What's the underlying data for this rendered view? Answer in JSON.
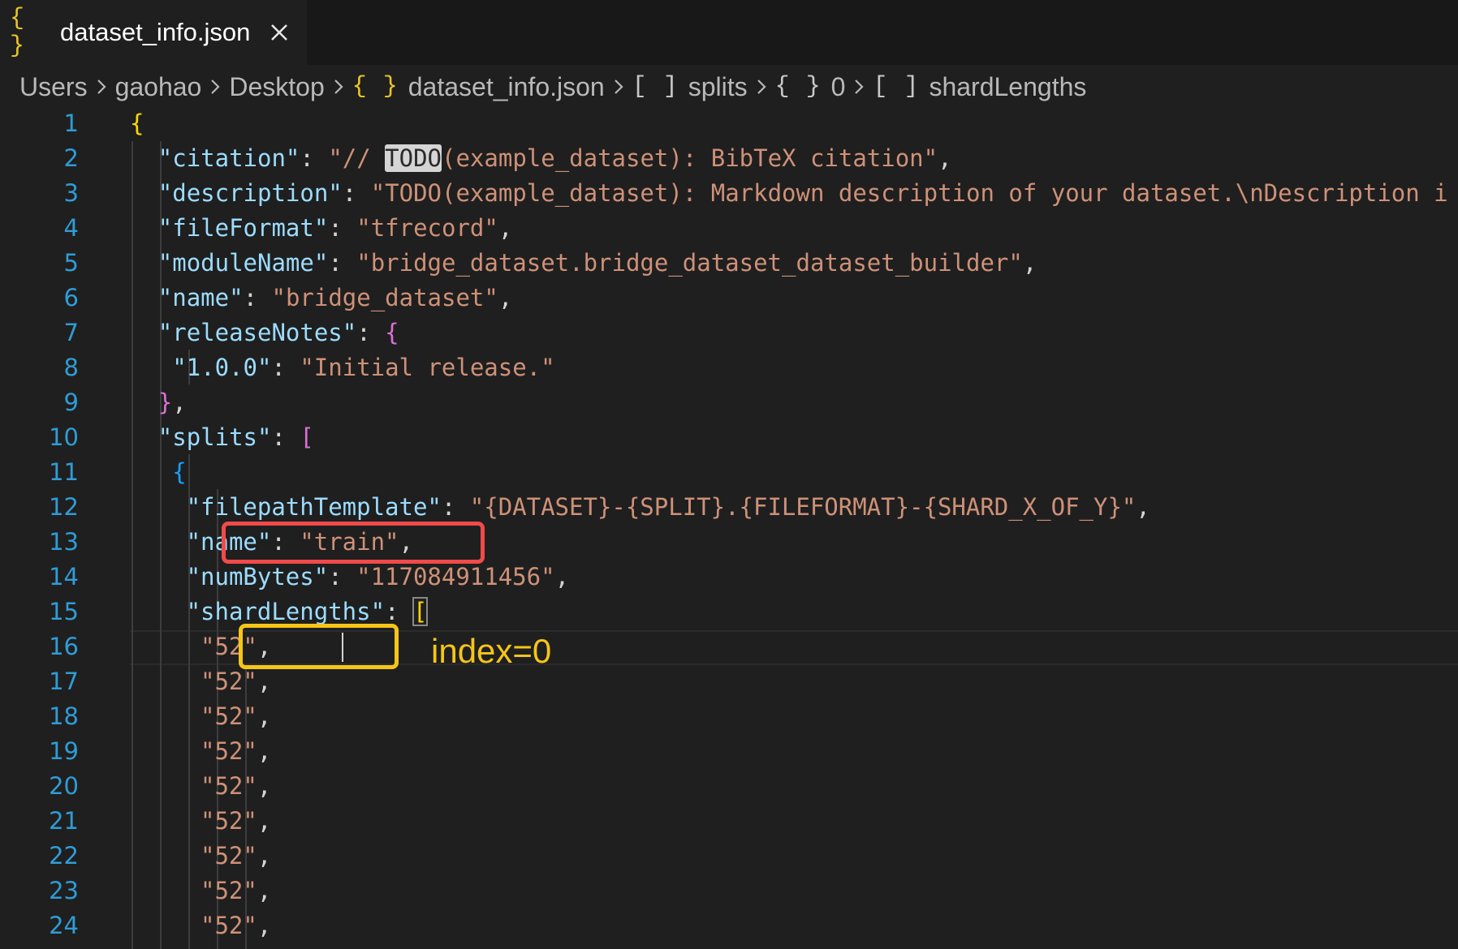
{
  "tab": {
    "icon": "{ }",
    "label": "dataset_info.json",
    "close_icon": "close-icon"
  },
  "breadcrumb": [
    {
      "icon": "",
      "label": "Users"
    },
    {
      "icon": "",
      "label": "gaohao"
    },
    {
      "icon": "",
      "label": "Desktop"
    },
    {
      "icon": "{ }",
      "label": "dataset_info.json"
    },
    {
      "icon": "[ ]",
      "label": "splits"
    },
    {
      "icon": "{ }",
      "label": "0"
    },
    {
      "icon": "[ ]",
      "label": "shardLengths"
    }
  ],
  "editor": {
    "colors": {
      "key": "#9cdcfe",
      "string": "#ce9178",
      "punctuation": "#d4d4d4",
      "line_number": "#2f9cd6",
      "bracket_level1": "#ffd700",
      "bracket_level2": "#da70d6",
      "bracket_level3": "#179fff"
    },
    "lines": [
      {
        "num": "1",
        "tokens": [
          [
            "b1",
            "{"
          ]
        ]
      },
      {
        "num": "2",
        "tokens": [
          [
            "k",
            "\"citation\""
          ],
          [
            "p",
            ": "
          ],
          [
            "s",
            "\"// "
          ],
          [
            "todo",
            "TODO"
          ],
          [
            "s",
            "(example_dataset): BibTeX citation\""
          ],
          [
            "p",
            ","
          ]
        ]
      },
      {
        "num": "3",
        "tokens": [
          [
            "k",
            "\"description\""
          ],
          [
            "p",
            ": "
          ],
          [
            "s",
            "\"TODO(example_dataset): Markdown description of your dataset.\\nDescription i"
          ]
        ]
      },
      {
        "num": "4",
        "tokens": [
          [
            "k",
            "\"fileFormat\""
          ],
          [
            "p",
            ": "
          ],
          [
            "s",
            "\"tfrecord\""
          ],
          [
            "p",
            ","
          ]
        ]
      },
      {
        "num": "5",
        "tokens": [
          [
            "k",
            "\"moduleName\""
          ],
          [
            "p",
            ": "
          ],
          [
            "s",
            "\"bridge_dataset.bridge_dataset_dataset_builder\""
          ],
          [
            "p",
            ","
          ]
        ]
      },
      {
        "num": "6",
        "tokens": [
          [
            "k",
            "\"name\""
          ],
          [
            "p",
            ": "
          ],
          [
            "s",
            "\"bridge_dataset\""
          ],
          [
            "p",
            ","
          ]
        ]
      },
      {
        "num": "7",
        "tokens": [
          [
            "k",
            "\"releaseNotes\""
          ],
          [
            "p",
            ": "
          ],
          [
            "b2",
            "{"
          ]
        ]
      },
      {
        "num": "8",
        "tokens": [
          [
            "k",
            "\"1.0.0\""
          ],
          [
            "p",
            ": "
          ],
          [
            "s",
            "\"Initial release.\""
          ]
        ]
      },
      {
        "num": "9",
        "tokens": [
          [
            "b2",
            "}"
          ],
          [
            "p",
            ","
          ]
        ]
      },
      {
        "num": "10",
        "tokens": [
          [
            "k",
            "\"splits\""
          ],
          [
            "p",
            ": "
          ],
          [
            "b2",
            "["
          ]
        ]
      },
      {
        "num": "11",
        "tokens": [
          [
            "b3",
            "{"
          ]
        ]
      },
      {
        "num": "12",
        "tokens": [
          [
            "k",
            "\"filepathTemplate\""
          ],
          [
            "p",
            ": "
          ],
          [
            "s",
            "\"{DATASET}-{SPLIT}.{FILEFORMAT}-{SHARD_X_OF_Y}\""
          ],
          [
            "p",
            ","
          ]
        ]
      },
      {
        "num": "13",
        "tokens": [
          [
            "k",
            "\"name\""
          ],
          [
            "p",
            ": "
          ],
          [
            "s",
            "\"train\""
          ],
          [
            "p",
            ","
          ]
        ]
      },
      {
        "num": "14",
        "tokens": [
          [
            "k",
            "\"numBytes\""
          ],
          [
            "p",
            ": "
          ],
          [
            "s",
            "\"117084911456\""
          ],
          [
            "p",
            ","
          ]
        ]
      },
      {
        "num": "15",
        "tokens": [
          [
            "k",
            "\"shardLengths\""
          ],
          [
            "p",
            ": "
          ],
          [
            "bm",
            "["
          ]
        ]
      },
      {
        "num": "16",
        "tokens": [
          [
            "s",
            "\"52\""
          ],
          [
            "p",
            ","
          ]
        ]
      },
      {
        "num": "17",
        "tokens": [
          [
            "s",
            "\"52\""
          ],
          [
            "p",
            ","
          ]
        ]
      },
      {
        "num": "18",
        "tokens": [
          [
            "s",
            "\"52\""
          ],
          [
            "p",
            ","
          ]
        ]
      },
      {
        "num": "19",
        "tokens": [
          [
            "s",
            "\"52\""
          ],
          [
            "p",
            ","
          ]
        ]
      },
      {
        "num": "20",
        "tokens": [
          [
            "s",
            "\"52\""
          ],
          [
            "p",
            ","
          ]
        ]
      },
      {
        "num": "21",
        "tokens": [
          [
            "s",
            "\"52\""
          ],
          [
            "p",
            ","
          ]
        ]
      },
      {
        "num": "22",
        "tokens": [
          [
            "s",
            "\"52\""
          ],
          [
            "p",
            ","
          ]
        ]
      },
      {
        "num": "23",
        "tokens": [
          [
            "s",
            "\"52\""
          ],
          [
            "p",
            ","
          ]
        ]
      },
      {
        "num": "24",
        "tokens": [
          [
            "s",
            "\"52\""
          ],
          [
            "p",
            ","
          ]
        ]
      }
    ]
  },
  "annotations": {
    "label": "index=0",
    "red_box_color": "#f04a4a",
    "yellow_box_color": "#f5c518"
  }
}
